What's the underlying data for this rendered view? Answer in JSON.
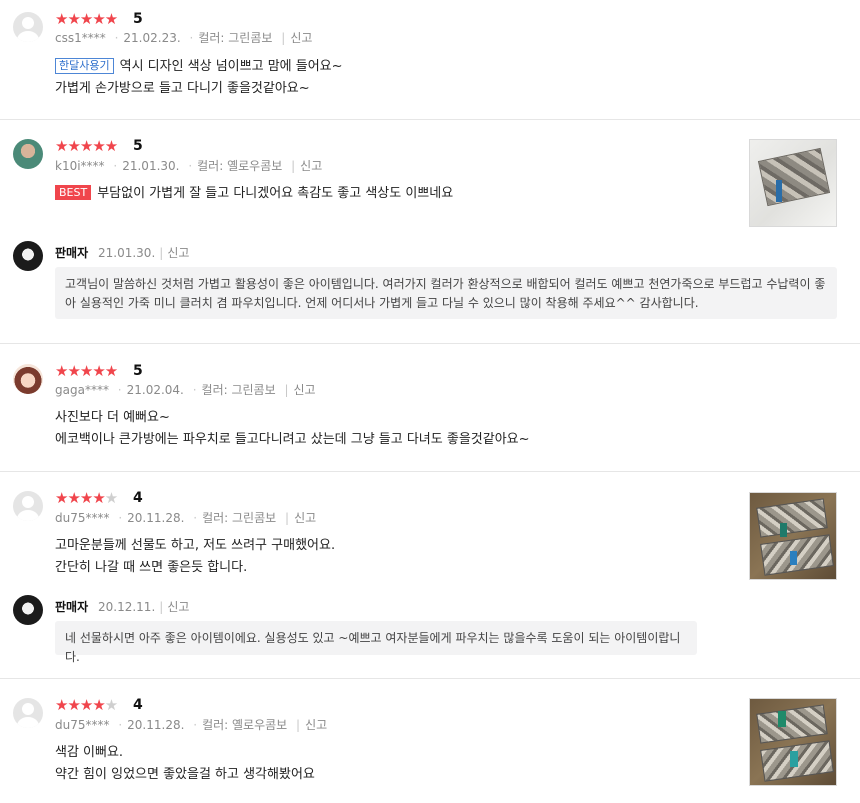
{
  "reviews": [
    {
      "id": "r1",
      "avatar": "default-avatar",
      "rating": 5,
      "score_text": "5",
      "user": "css1****",
      "date": "21.02.23.",
      "option": "컬러: 그린콤보",
      "report": "신고",
      "tag": "한달사용기",
      "lines": [
        "역시 디자인 색상 넘이쁘고 맘에 들어요~",
        "가볍게 손가방으로 들고 다니기 좋을것같아요~"
      ]
    },
    {
      "id": "r2",
      "avatar": "user-photo-avatar",
      "rating": 5,
      "score_text": "5",
      "user": "k10i****",
      "date": "21.01.30.",
      "option": "컬러: 옐로우콤보",
      "report": "신고",
      "tag": "BEST",
      "lines": [
        "부담없이  가볍게 잘 들고 다니겠어요 촉감도 좋고  색상도 이쁘네요"
      ],
      "reply": {
        "author": "판매자",
        "date": "21.01.30.",
        "report": "신고",
        "text_lines": [
          "고객님이 말씀하신 것처럼 가볍고 활용성이 좋은 아이템입니다. 여러가지 컬러가 환상적으로 배합되어 컬러도 예쁘고 천연가죽으로 부드럽고 수납력이 좋",
          "아 실용적인 가죽 미니 클러치 겸 파우치입니다. 언제 어디서나 가볍게 들고 다닐 수 있으니 많이 착용해 주세요^^ 감사합니다."
        ]
      }
    },
    {
      "id": "r3",
      "avatar": "character-avatar",
      "rating": 5,
      "score_text": "5",
      "user": "gaga****",
      "date": "21.02.04.",
      "option": "컬러: 그린콤보",
      "report": "신고",
      "lines": [
        "사진보다 더 예뻐요~",
        "에코백이나 큰가방에는 파우치로 들고다니려고 샀는데 그냥 들고 다녀도 좋을것같아요~"
      ]
    },
    {
      "id": "r4",
      "avatar": "default-avatar",
      "rating": 4,
      "score_text": "4",
      "user": "du75****",
      "date": "20.11.28.",
      "option": "컬러: 그린콤보",
      "report": "신고",
      "lines": [
        "고마운분들께 선물도 하고, 저도 쓰려구 구매했어요.",
        "간단히 나갈 때 쓰면 좋은듯 합니다."
      ],
      "reply": {
        "author": "판매자",
        "date": "20.12.11.",
        "report": "신고",
        "text_lines": [
          "네 선물하시면 아주 좋은 아이템이에요. 실용성도 있고 ~예쁘고 여자분들에게 파우치는 많을수록 도움이 되는 아이템이랍니다."
        ]
      }
    },
    {
      "id": "r5",
      "avatar": "default-avatar",
      "rating": 4,
      "score_text": "4",
      "user": "du75****",
      "date": "20.11.28.",
      "option": "컬러: 옐로우콤보",
      "report": "신고",
      "lines": [
        "색감 이뻐요.",
        "약간 힘이 잉었으면 좋았을걸 하고  생각해봤어요"
      ]
    }
  ],
  "star_glyph": "★",
  "colors": {
    "star_on": "#f0454c",
    "star_off": "#cfcfcf",
    "best_tag": "#f0454c",
    "tag_outline": "#2e6fcc"
  }
}
